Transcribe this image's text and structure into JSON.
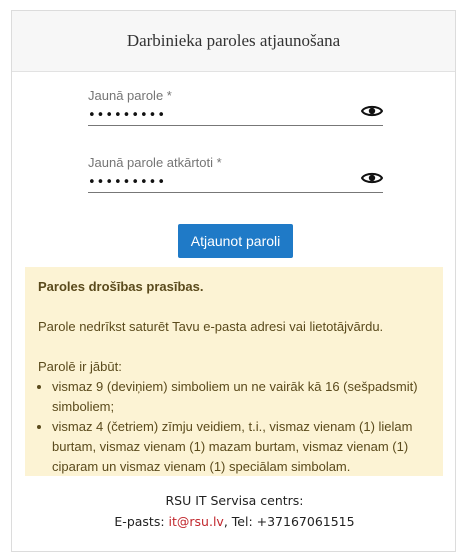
{
  "header": {
    "title": "Darbinieka paroles atjaunošana"
  },
  "form": {
    "new_password": {
      "label": "Jaunā parole *",
      "value": "•••••••••"
    },
    "repeat_password": {
      "label": "Jaunā parole atkārtoti *",
      "value": "•••••••••"
    },
    "submit_label": "Atjaunot paroli"
  },
  "requirements": {
    "title": "Paroles drošības prasības.",
    "rule_text": "Parole nedrīkst saturēt Tavu e-pasta adresi vai lietotājvārdu.",
    "must_have_intro": "Parolē ir jābūt:",
    "items": [
      "vismaz 9 (deviņiem) simboliem un ne vairāk kā 16 (sešpadsmit) simboliem;",
      "vismaz 4 (četriem) zīmju veidiem, t.i., vismaz vienam (1) lielam burtam, vismaz vienam (1) mazam burtam, vismaz vienam (1) ciparam un vismaz vienam (1) speciālam simbolam."
    ]
  },
  "footer": {
    "org": "RSU IT Servisa centrs:",
    "email_label": "E-pasts: ",
    "email": "it@rsu.lv",
    "phone_text": ", Tel: +37167061515"
  },
  "icons": {
    "toggle_visibility": "eye-icon"
  },
  "colors": {
    "button": "#1f7ac7",
    "notice_bg": "#fcf3d4",
    "link": "#c1272d"
  }
}
